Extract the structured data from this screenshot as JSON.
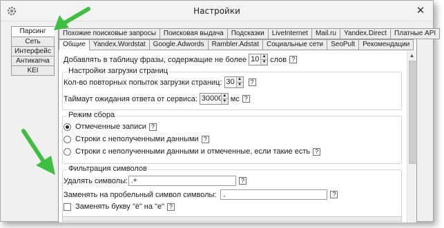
{
  "window": {
    "title": "Настройки",
    "close_glyph": "✕",
    "app_icon": "gear-icon"
  },
  "left_tabs": [
    {
      "label": "Парсинг",
      "active": true
    },
    {
      "label": "Сеть",
      "active": false
    },
    {
      "label": "Интерфейс",
      "active": false
    },
    {
      "label": "Антикапча",
      "active": false
    },
    {
      "label": "KEI",
      "active": false
    }
  ],
  "top_tabs_row1": [
    "Похожие поисковые запросы",
    "Поисковая выдача",
    "Подсказки",
    "LiveInternet",
    "Mail.ru",
    "Yandex.Direct",
    "Платные API"
  ],
  "top_tabs_row2": [
    {
      "label": "Общие",
      "active": true
    },
    {
      "label": "Yandex.Wordstat",
      "active": false
    },
    {
      "label": "Google.Adwords",
      "active": false
    },
    {
      "label": "Rambler.Adstat",
      "active": false
    },
    {
      "label": "Социальные сети",
      "active": false
    },
    {
      "label": "SeoPult",
      "active": false
    },
    {
      "label": "Рекомендации",
      "active": false
    }
  ],
  "general": {
    "max_words_prefix": "Добавлять в таблицу фразы, содержащие не более",
    "max_words_value": "10",
    "max_words_suffix": "слов",
    "help": "?"
  },
  "page_load": {
    "title": "Настройки загрузки страниц",
    "retries_label": "Кол-во повторных попыток загрузки страниц:",
    "retries_value": "30",
    "timeout_label": "Таймаут ожидания ответа от сервиса:",
    "timeout_value": "30000",
    "timeout_unit": "мс"
  },
  "collection_mode": {
    "title": "Режим сбора",
    "options": [
      {
        "label": "Отмеченные записи",
        "selected": true
      },
      {
        "label": "Строки с неполученными данными",
        "selected": false
      },
      {
        "label": "Строки с неполученными данными и отмеченные, если такие есть",
        "selected": false
      }
    ]
  },
  "char_filter": {
    "title": "Фильтрация символов",
    "remove_label": "Удалять символы:",
    "remove_value": ".+",
    "replace_label": "Заменять на пробельный символ символы:",
    "replace_value": ",",
    "yo_label": "Заменять букву \"ё\" на \"е\"",
    "yo_checked": false
  },
  "colors": {
    "arrow": "#3fbf3f",
    "window_bg": "#f0f0f0",
    "content_bg": "#ffffff"
  }
}
